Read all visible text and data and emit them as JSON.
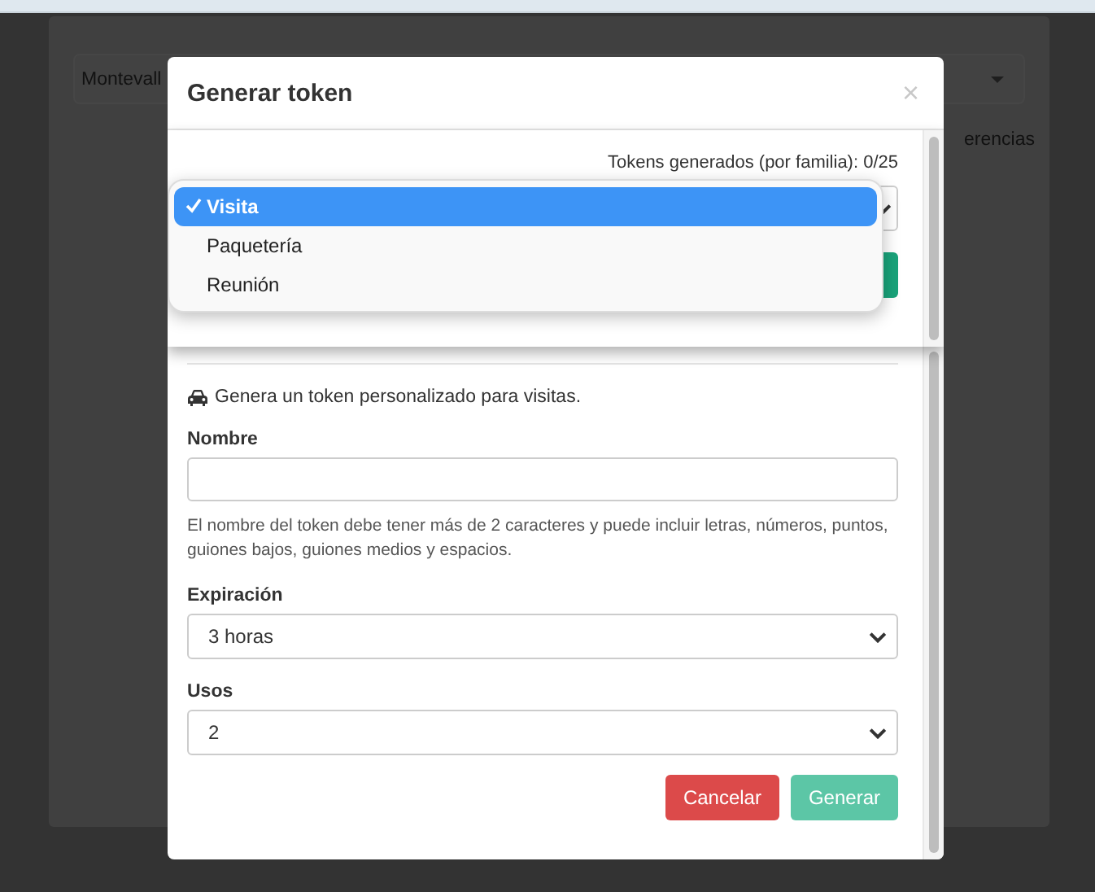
{
  "background": {
    "select_value": "Montevall",
    "label_fragment": "erencias"
  },
  "modal": {
    "title": "Generar token",
    "close": "×",
    "popup": {
      "counter": "Tokens generados (por familia): 0/25",
      "type_options": [
        {
          "label": "Visita",
          "selected": true
        },
        {
          "label": "Paquetería",
          "selected": false
        },
        {
          "label": "Reunión",
          "selected": false
        }
      ]
    },
    "description": "Genera un token personalizado para visitas.",
    "fields": [
      {
        "kind": "input",
        "label": "Nombre",
        "help": "El nombre del token debe tener más de 2 caracteres y puede incluir letras, números, puntos, guiones bajos, guiones medios y espacios."
      },
      {
        "kind": "select",
        "label": "Expiración",
        "value": "3 horas"
      },
      {
        "kind": "select",
        "label": "Usos",
        "value": "2"
      }
    ],
    "buttons": [
      {
        "label": "Cancelar",
        "kind": "danger",
        "disabled": false
      },
      {
        "label": "Generar",
        "kind": "success",
        "disabled": true
      }
    ]
  }
}
